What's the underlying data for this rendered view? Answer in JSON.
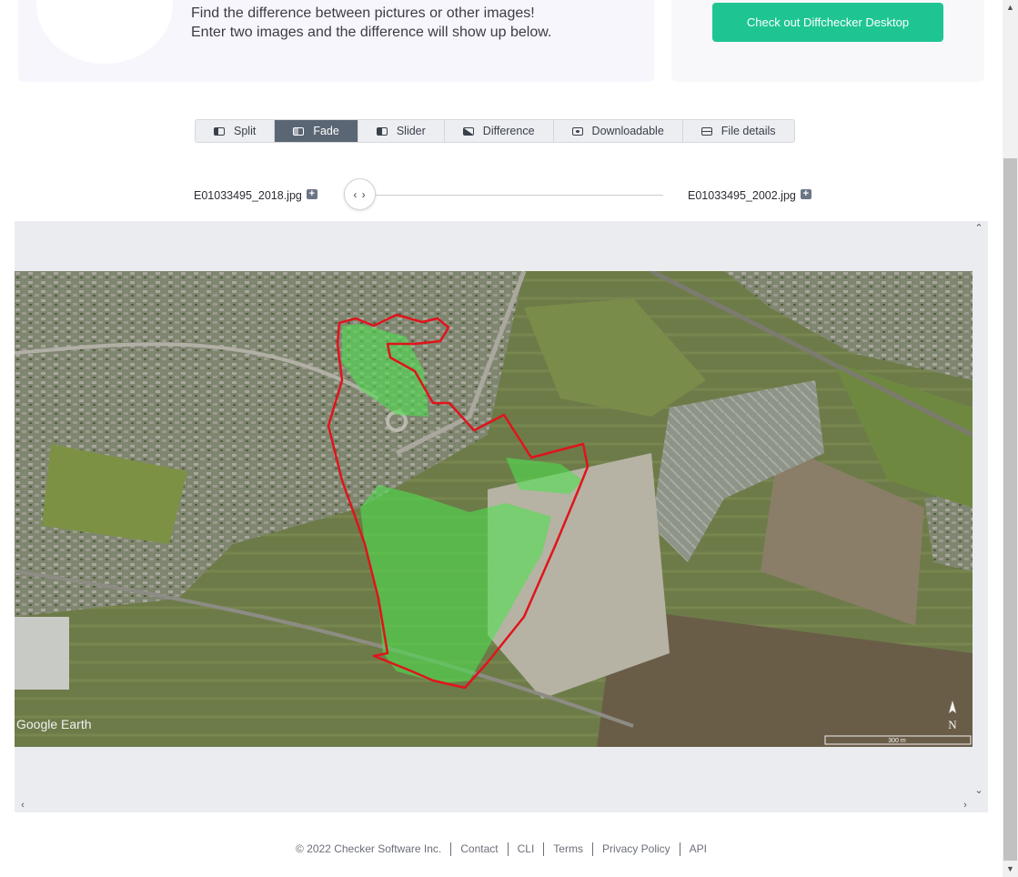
{
  "hero": {
    "line1": "Find the difference between pictures or other images!",
    "line2": "Enter two images and the difference will show up below."
  },
  "cta": {
    "label": "Check out Diffchecker Desktop",
    "color": "#1ec592"
  },
  "tabs": [
    {
      "label": "Split",
      "icon": "split-icon",
      "active": false
    },
    {
      "label": "Fade",
      "icon": "fade-icon",
      "active": true
    },
    {
      "label": "Slider",
      "icon": "slider-icon",
      "active": false
    },
    {
      "label": "Difference",
      "icon": "difference-icon",
      "active": false
    },
    {
      "label": "Downloadable",
      "icon": "downloadable-icon",
      "active": false
    },
    {
      "label": "File details",
      "icon": "file-details-icon",
      "active": false
    }
  ],
  "files": {
    "left": "E01033495_2018.jpg",
    "right": "E01033495_2002.jpg"
  },
  "slider": {
    "knob_glyph": "‹ ›"
  },
  "image": {
    "watermark": "Google Earth",
    "scale_label": "300 m",
    "north_label": "N"
  },
  "footer": {
    "copyright": "© 2022 Checker Software Inc.",
    "links": [
      "Contact",
      "CLI",
      "Terms",
      "Privacy Policy",
      "API"
    ]
  },
  "colors": {
    "accent": "#1ec592",
    "active_tab": "#5b6674",
    "boundary": "#e0141b",
    "highlight": "#4ee04e"
  }
}
